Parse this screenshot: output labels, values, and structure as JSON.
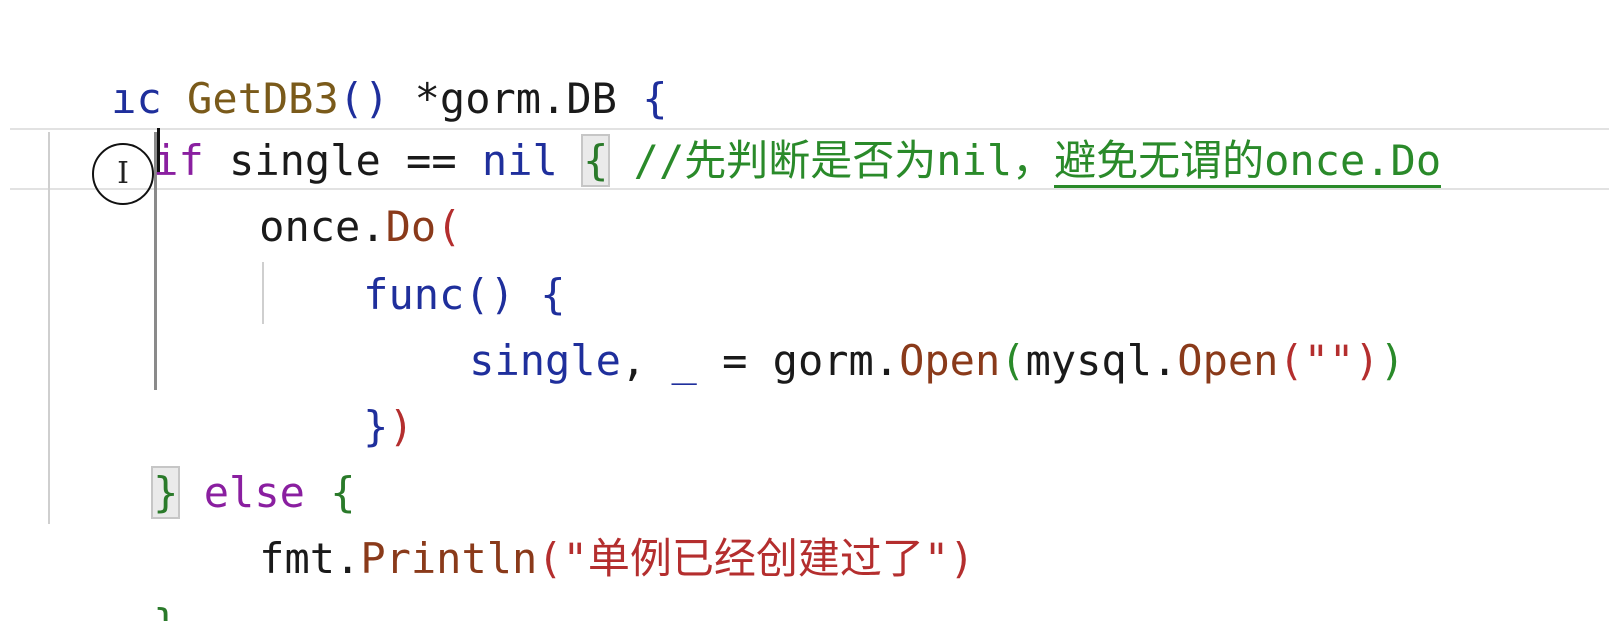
{
  "editor": {
    "language": "go",
    "lines": [
      {
        "tokens": [
          "ıc",
          "GetDB3",
          "()",
          "*gorm.DB",
          "{"
        ]
      },
      {
        "tokens": [
          "if",
          "single",
          "==",
          "nil",
          "{",
          "//先判断是否为nil，",
          "避免无谓的once.Do"
        ]
      },
      {
        "tokens": [
          "once",
          ".",
          "Do",
          "("
        ]
      },
      {
        "tokens": [
          "func",
          "()",
          "{"
        ]
      },
      {
        "tokens": [
          "single",
          ",",
          "_",
          "=",
          "gorm",
          ".",
          "Open",
          "(",
          "mysql",
          ".",
          "Open",
          "(",
          "\"\"",
          ")",
          ")"
        ]
      },
      {
        "tokens": [
          "}",
          ")"
        ]
      },
      {
        "tokens": [
          "}",
          "else",
          "{"
        ]
      },
      {
        "tokens": [
          "fmt",
          ".",
          "Println",
          "(",
          "\"单例已经创建过了\"",
          ")"
        ]
      },
      {
        "tokens": [
          "}"
        ]
      }
    ]
  },
  "cursor": {
    "icon": "i-beam-icon"
  },
  "colors": {
    "keyword": "#8a1fa0",
    "builtin_blue": "#1f2f9c",
    "function_call": "#8a3a1a",
    "string": "#b42e2e",
    "comment": "#2a8a2a"
  }
}
